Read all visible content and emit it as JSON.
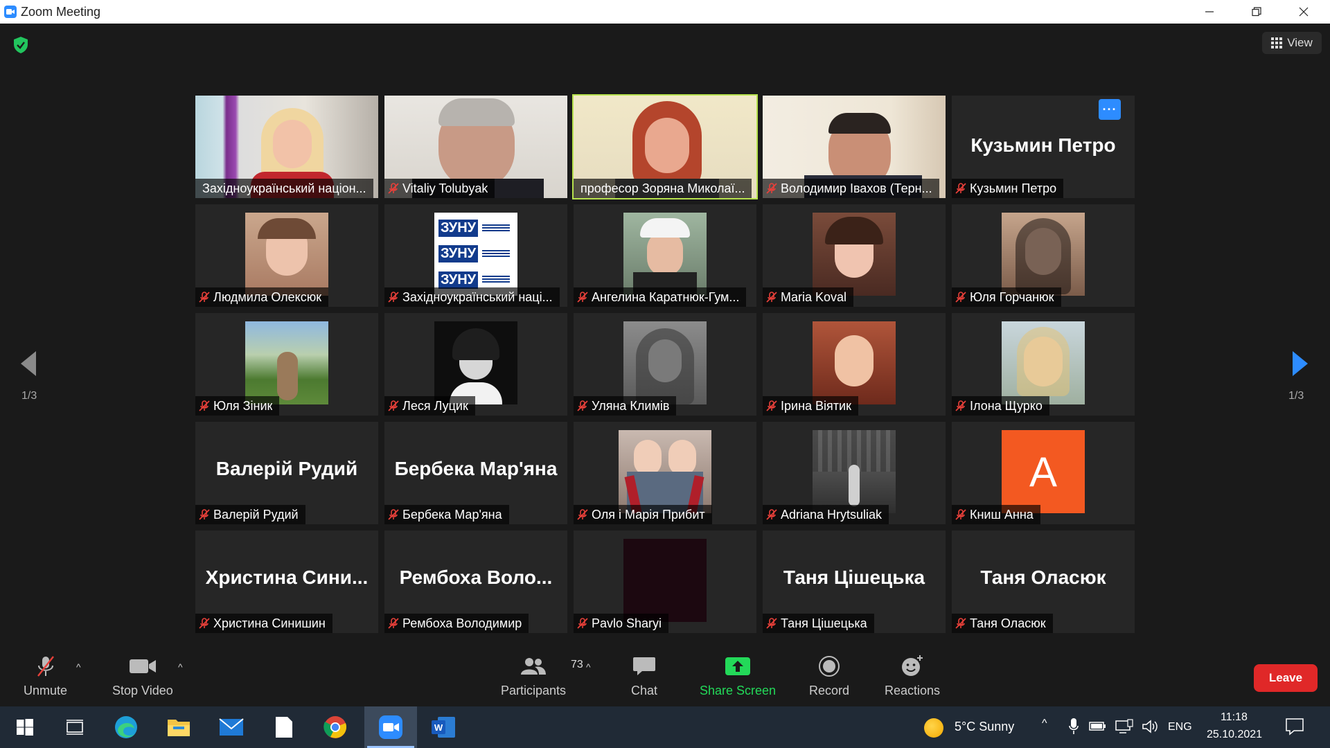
{
  "window": {
    "title": "Zoom Meeting"
  },
  "view_label": "View",
  "pagination": {
    "left": "1/3",
    "right": "1/3"
  },
  "participants": [
    {
      "tile_label": "Західноукраїнський націон...",
      "type": "video"
    },
    {
      "tile_label": "Vitaliy Tolubyak",
      "type": "video",
      "muted": true
    },
    {
      "tile_label": "професор Зоряна Миколаї...",
      "type": "video",
      "speaking": true
    },
    {
      "tile_label": "Володимир Івахов (Терн...",
      "type": "video",
      "muted": true
    },
    {
      "tile_label": "Кузьмин Петро",
      "display_name": "Кузьмин Петро",
      "type": "name",
      "muted": true
    },
    {
      "tile_label": "Людмила Олексюк",
      "type": "photo",
      "muted": true
    },
    {
      "tile_label": "Західноукраїнський наці...",
      "type": "logo",
      "muted": true,
      "logo_text": [
        "ЗУНУ",
        "ЗУНУ",
        "ЗУНУ"
      ]
    },
    {
      "tile_label": "Ангелина Каратнюк-Гум...",
      "type": "photo",
      "muted": true
    },
    {
      "tile_label": "Maria Koval",
      "type": "photo",
      "muted": true
    },
    {
      "tile_label": "Юля Горчанюк",
      "type": "photo",
      "muted": true
    },
    {
      "tile_label": "Юля Зіник",
      "type": "photo",
      "muted": true
    },
    {
      "tile_label": "Леся Луцик",
      "type": "photo",
      "muted": true
    },
    {
      "tile_label": "Уляна Климів",
      "type": "photo",
      "muted": true
    },
    {
      "tile_label": "Ірина Віятик",
      "type": "photo",
      "muted": true
    },
    {
      "tile_label": "Ілона Щурко",
      "type": "photo",
      "muted": true
    },
    {
      "tile_label": "Валерій Рудий",
      "display_name": "Валерій Рудий",
      "type": "name",
      "muted": true
    },
    {
      "tile_label": "Бербека Мар'яна",
      "display_name": "Бербека Мар'яна",
      "type": "name",
      "muted": true
    },
    {
      "tile_label": "Оля і Марія Прибит",
      "type": "photo",
      "muted": true
    },
    {
      "tile_label": "Adriana Hrytsuliak",
      "type": "photo",
      "muted": true
    },
    {
      "tile_label": "Книш Анна",
      "type": "letter",
      "letter": "A",
      "muted": true
    },
    {
      "tile_label": "Христина Синишин",
      "display_name": "Христина  Сини...",
      "type": "name",
      "muted": true
    },
    {
      "tile_label": "Рембоха Володимир",
      "display_name": "Рембоха  Воло...",
      "type": "name",
      "muted": true
    },
    {
      "tile_label": "Pavlo Sharyi",
      "type": "dark",
      "muted": true
    },
    {
      "tile_label": "Таня Цішецька",
      "display_name": "Таня Цішецька",
      "type": "name",
      "muted": true
    },
    {
      "tile_label": "Таня Оласюк",
      "display_name": "Таня Оласюк",
      "type": "name",
      "muted": true
    }
  ],
  "toolbar": {
    "unmute": "Unmute",
    "stop_video": "Stop Video",
    "participants_count": "73",
    "participants": "Participants",
    "chat": "Chat",
    "share_screen": "Share Screen",
    "record": "Record",
    "reactions": "Reactions",
    "leave": "Leave"
  },
  "taskbar": {
    "weather": "5°C  Sunny",
    "language": "ENG",
    "time": "11:18",
    "date": "25.10.2021"
  },
  "colors": {
    "accent": "#2d8cff",
    "share_green": "#23d959",
    "leave_red": "#e02828",
    "speaking_border": "#b7e24d",
    "muted_red": "#e8403a"
  }
}
